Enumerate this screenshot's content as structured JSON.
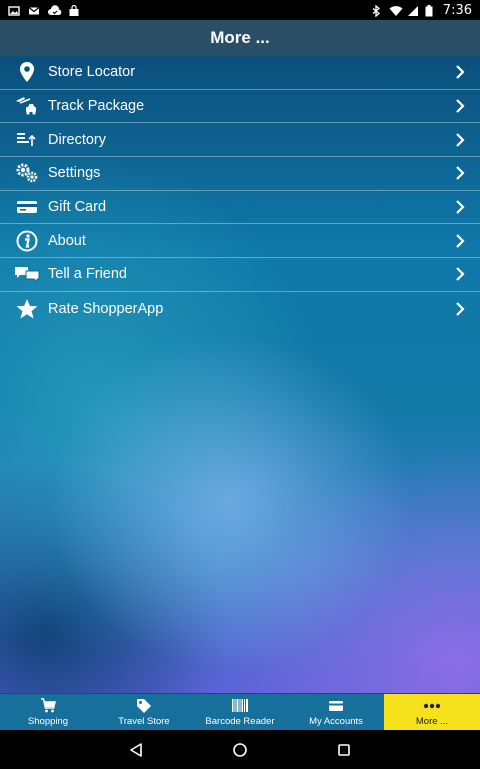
{
  "status_bar": {
    "time": "7:36",
    "left_icons": [
      "image-icon",
      "gmail-icon",
      "cloud-icon",
      "bag-icon"
    ],
    "right_icons": [
      "bluetooth-icon",
      "wifi-icon",
      "signal-icon",
      "battery-icon"
    ]
  },
  "header": {
    "title": "More ..."
  },
  "menu": {
    "items": [
      {
        "label": "Store Locator",
        "icon": "map-pin-icon"
      },
      {
        "label": "Track Package",
        "icon": "track-package-icon"
      },
      {
        "label": "Directory",
        "icon": "directory-icon"
      },
      {
        "label": "Settings",
        "icon": "gears-icon"
      },
      {
        "label": "Gift Card",
        "icon": "gift-card-icon"
      },
      {
        "label": "About",
        "icon": "info-icon"
      },
      {
        "label": "Tell a Friend",
        "icon": "chat-bubbles-icon"
      },
      {
        "label": "Rate ShopperApp",
        "icon": "star-icon"
      }
    ]
  },
  "tabs": [
    {
      "label": "Shopping",
      "icon": "cart-icon",
      "active": false
    },
    {
      "label": "Travel Store",
      "icon": "tag-icon",
      "active": false
    },
    {
      "label": "Barcode Reader",
      "icon": "barcode-icon",
      "active": false
    },
    {
      "label": "My Accounts",
      "icon": "card-icon",
      "active": false
    },
    {
      "label": "More ...",
      "icon": "more-dots-icon",
      "active": true
    }
  ],
  "colors": {
    "title_bar": "#2a4e66",
    "tab_bar": "#17709b",
    "active_tab": "#f5e21b"
  }
}
